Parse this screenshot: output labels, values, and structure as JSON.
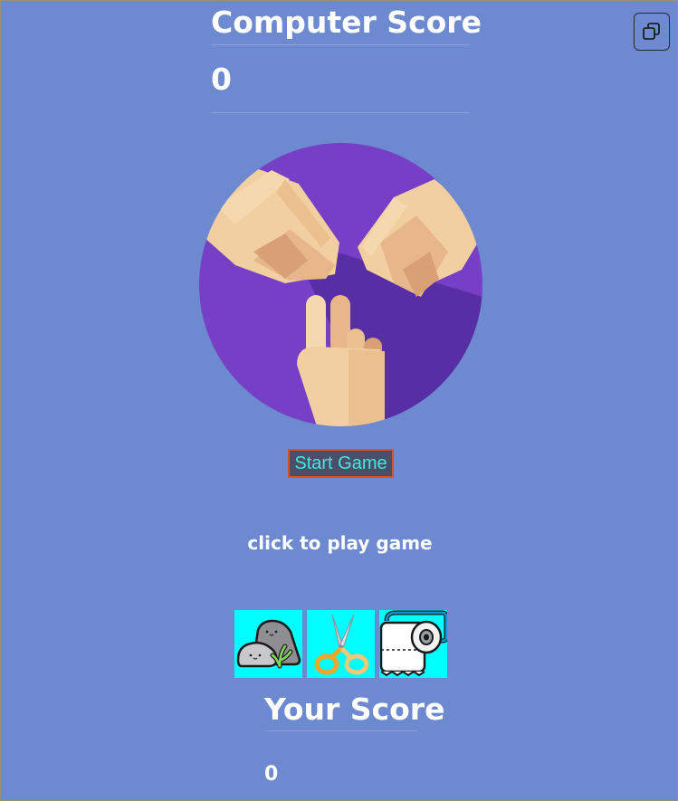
{
  "computer": {
    "title": "Computer Score",
    "score": "0"
  },
  "start_button": {
    "label": "Start Game"
  },
  "status": {
    "hint": "click to play game"
  },
  "choices": [
    {
      "name": "rock",
      "icon": "rock-icon"
    },
    {
      "name": "scissors",
      "icon": "scissors-icon"
    },
    {
      "name": "paper",
      "icon": "toilet-paper-icon"
    }
  ],
  "player": {
    "title": "Your Score",
    "score": "0"
  },
  "colors": {
    "background": "#6d89cf",
    "hero_circle": "#763fc6",
    "choice_bg": "#00ffff",
    "button_bg": "#4a4e69",
    "button_border": "#d2522f",
    "button_text": "#41e9e0"
  }
}
